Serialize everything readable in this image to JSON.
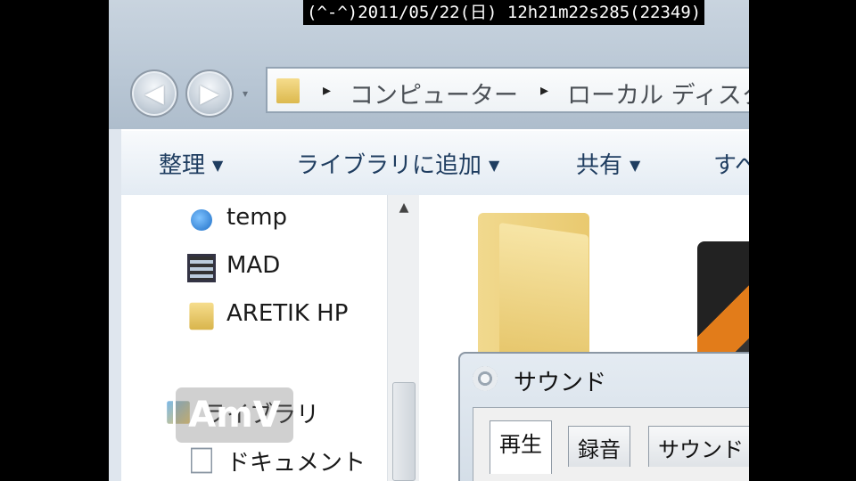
{
  "overlay": {
    "timestamp": "(^-^)2011/05/22(日) 12h21m22s285(22349)"
  },
  "navigation": {
    "back_glyph": "◀",
    "forward_glyph": "▶",
    "history_glyph": "▾"
  },
  "address_bar": {
    "crumbs": [
      "コンピューター",
      "ローカル ディスク"
    ],
    "separator": "▸"
  },
  "toolbar": {
    "organize": "整理",
    "add_to_library": "ライブラリに追加",
    "share": "共有",
    "more": "すべ",
    "caret": "▼"
  },
  "nav_pane": {
    "items": [
      {
        "label": "temp",
        "icon": "network-folder-icon"
      },
      {
        "label": "MAD",
        "icon": "video-folder-icon"
      },
      {
        "label": "ARETIK HP",
        "icon": "folder-icon"
      },
      {
        "label": "ライブラリ",
        "icon": "library-icon"
      },
      {
        "label": "ドキュメント",
        "icon": "document-icon"
      }
    ],
    "scroll_up_glyph": "▲"
  },
  "watermark": {
    "text": "AmV"
  },
  "sound_dialog": {
    "title": "サウンド",
    "tabs": [
      "再生",
      "録音",
      "サウンド"
    ],
    "active_tab": "再生"
  }
}
